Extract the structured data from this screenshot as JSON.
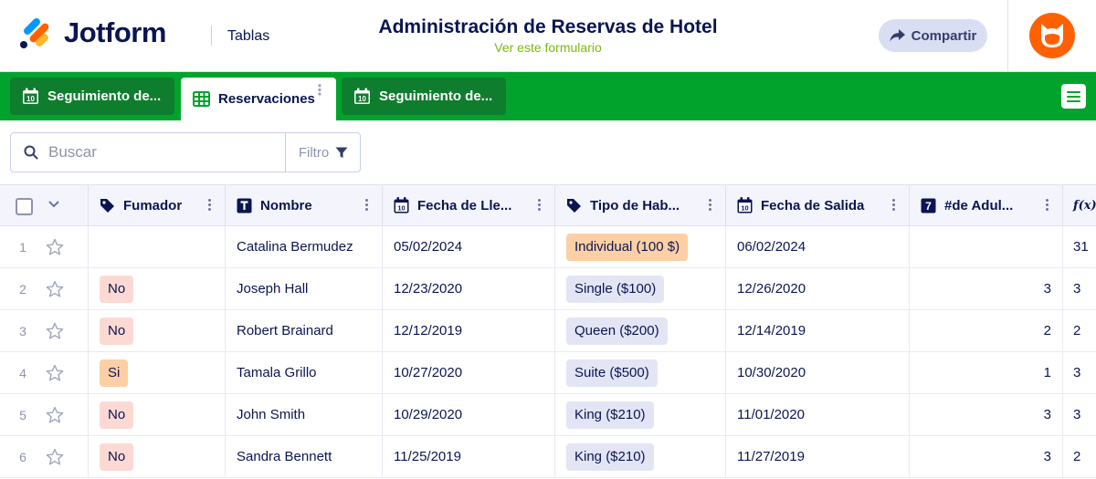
{
  "header": {
    "brand": "Jotform",
    "section": "Tablas",
    "title": "Administración de Reservas de Hotel",
    "subtitle": "Ver este formulario",
    "share_label": "Compartir"
  },
  "tabs": [
    {
      "label": "Seguimiento de...",
      "icon": "calendar-icon"
    },
    {
      "label": "Reservaciones",
      "icon": "grid-table-icon"
    },
    {
      "label": "Seguimiento de...",
      "icon": "calendar-icon"
    }
  ],
  "search": {
    "placeholder": "Buscar",
    "filter_label": "Filtro"
  },
  "columns": [
    {
      "label": "Fumador",
      "icon": "tag-icon"
    },
    {
      "label": "Nombre",
      "icon": "text-icon"
    },
    {
      "label": "Fecha de Lle...",
      "icon": "calendar-icon"
    },
    {
      "label": "Tipo de Hab...",
      "icon": "tag-icon"
    },
    {
      "label": "Fecha de Salida",
      "icon": "calendar-icon"
    },
    {
      "label": "#de Adul...",
      "icon": "number-icon"
    },
    {
      "label": "f(x)",
      "icon": "formula-icon"
    }
  ],
  "rows": [
    {
      "n": "1",
      "fumador": "",
      "nombre": "Catalina Bermudez",
      "llegada": "05/02/2024",
      "tipo": "Individual (100 $)",
      "salida": "06/02/2024",
      "adultos": "",
      "fx": "31"
    },
    {
      "n": "2",
      "fumador": "No",
      "nombre": "Joseph Hall",
      "llegada": "12/23/2020",
      "tipo": "Single ($100)",
      "salida": "12/26/2020",
      "adultos": "3",
      "fx": "3"
    },
    {
      "n": "3",
      "fumador": "No",
      "nombre": "Robert Brainard",
      "llegada": "12/12/2019",
      "tipo": "Queen ($200)",
      "salida": "12/14/2019",
      "adultos": "2",
      "fx": "2"
    },
    {
      "n": "4",
      "fumador": "Si",
      "nombre": "Tamala Grillo",
      "llegada": "10/27/2020",
      "tipo": "Suite ($500)",
      "salida": "10/30/2020",
      "adultos": "1",
      "fx": "3"
    },
    {
      "n": "5",
      "fumador": "No",
      "nombre": "John Smith",
      "llegada": "10/29/2020",
      "tipo": "King ($210)",
      "salida": "11/01/2020",
      "adultos": "3",
      "fx": "3"
    },
    {
      "n": "6",
      "fumador": "No",
      "nombre": "Sandra Bennett",
      "llegada": "11/25/2019",
      "tipo": "King ($210)",
      "salida": "11/27/2019",
      "adultos": "3",
      "fx": "2"
    }
  ],
  "colors": {
    "brand_green": "#01a32c",
    "tab_dark": "#0f7d2e",
    "navy": "#0a1551",
    "orange": "#ff6100",
    "subtitle_green": "#78bb07"
  }
}
